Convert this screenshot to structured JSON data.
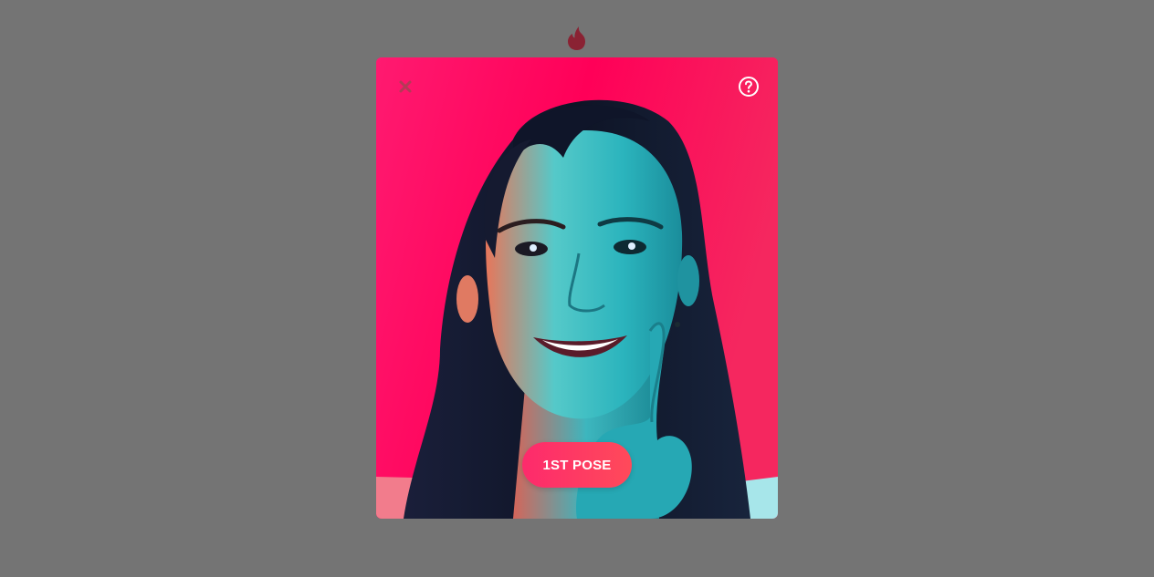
{
  "app": {
    "logo_icon": "flame-icon",
    "logo_color": "#8a2233"
  },
  "modal": {
    "close_icon": "close-icon",
    "help_icon": "question-circle-icon",
    "pose_button_label": "1ST POSE",
    "photo_description_icon": "portrait-photo",
    "accent": "#fd2a6c",
    "background_color": "#ff0a5a"
  }
}
